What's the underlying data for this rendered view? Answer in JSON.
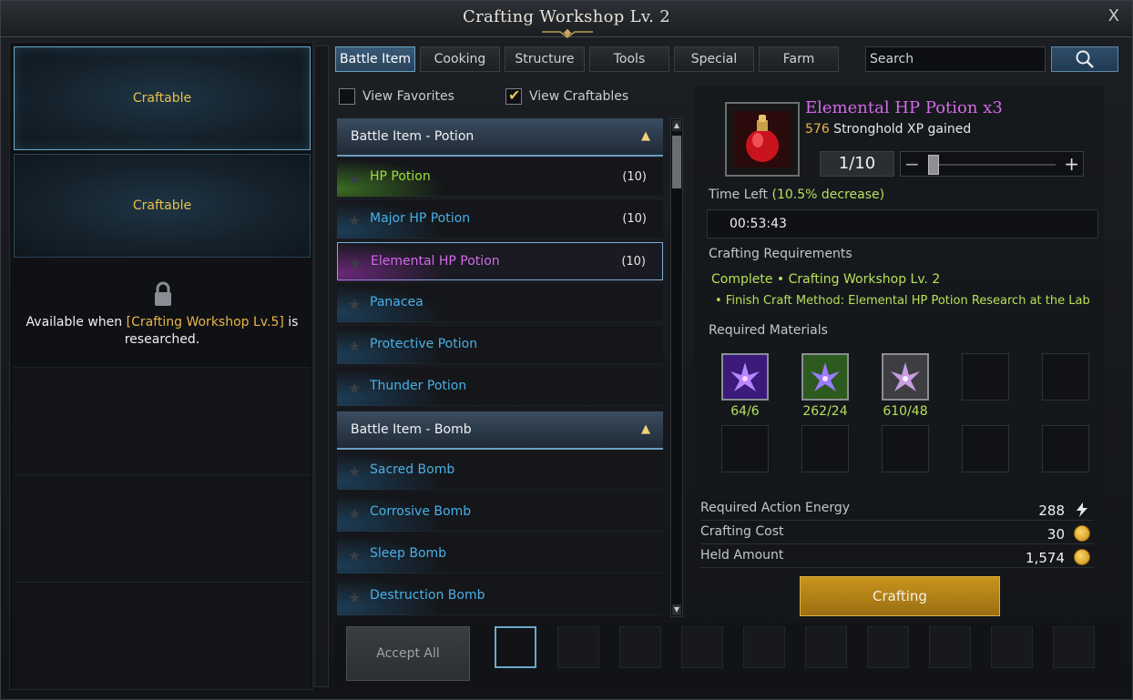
{
  "window": {
    "title": "Crafting Workshop Lv. 2",
    "close_label": "X"
  },
  "left": {
    "slots": [
      {
        "label": "Craftable"
      },
      {
        "label": "Craftable"
      }
    ],
    "locked": {
      "prefix": "Available when ",
      "highlight": "[Crafting Workshop Lv.5]",
      "suffix": " is",
      "line2": "researched."
    }
  },
  "tabs": [
    {
      "label": "Battle Item",
      "active": true
    },
    {
      "label": "Cooking"
    },
    {
      "label": "Structure"
    },
    {
      "label": "Tools"
    },
    {
      "label": "Special"
    },
    {
      "label": "Farm"
    }
  ],
  "search": {
    "placeholder": "Search",
    "icon": "magnifier-icon"
  },
  "filters": {
    "favorites": "View Favorites",
    "favorites_checked": false,
    "craftables": "View Craftables",
    "craftables_checked": true
  },
  "list": {
    "categories": [
      {
        "label": "Battle Item - Potion"
      },
      {
        "label": "Battle Item - Bomb"
      }
    ],
    "potions": [
      {
        "name": "HP Potion",
        "count": "(10)",
        "tone": "green"
      },
      {
        "name": "Major HP Potion",
        "count": "(10)",
        "tone": "blue"
      },
      {
        "name": "Elemental HP Potion",
        "count": "(10)",
        "tone": "purple"
      },
      {
        "name": "Panacea",
        "count": "",
        "tone": "blue"
      },
      {
        "name": "Protective Potion",
        "count": "",
        "tone": "blue"
      },
      {
        "name": "Thunder Potion",
        "count": "",
        "tone": "blue"
      }
    ],
    "bombs": [
      {
        "name": "Sacred Bomb",
        "count": "",
        "tone": "blue"
      },
      {
        "name": "Corrosive Bomb",
        "count": "",
        "tone": "blue"
      },
      {
        "name": "Sleep Bomb",
        "count": "",
        "tone": "blue"
      },
      {
        "name": "Destruction Bomb",
        "count": "",
        "tone": "blue"
      }
    ]
  },
  "detail": {
    "item_name": "Elemental HP Potion x3",
    "xp_num": "576",
    "xp_text": " Stronghold XP gained",
    "quantity": "1/10",
    "quantity_fraction": 0.1,
    "time_left_label": "Time Left ",
    "time_left_bonus": "(10.5% decrease)",
    "timer": "00:53:43",
    "req_title": "Crafting Requirements",
    "req_line1": "Complete  •  Crafting Workshop Lv. 2",
    "req_line2": "• Finish Craft Method: Elemental HP Potion Research at the Lab",
    "materials_title": "Required Materials",
    "materials": [
      {
        "qty": "64/6",
        "color": "#7a3bd6"
      },
      {
        "qty": "262/24",
        "color": "#6b4ad8"
      },
      {
        "qty": "610/48",
        "color": "#a26ac9"
      }
    ],
    "stats": [
      {
        "label": "Required Action Energy",
        "value": "288",
        "icon": "energy-icon"
      },
      {
        "label": "Crafting Cost",
        "value": "30",
        "icon": "gold-coin-icon"
      },
      {
        "label": "Held Amount",
        "value": "1,574",
        "icon": "gold-coin-icon"
      }
    ],
    "craft_button": "Crafting"
  },
  "bottom": {
    "accept_all": "Accept All"
  }
}
